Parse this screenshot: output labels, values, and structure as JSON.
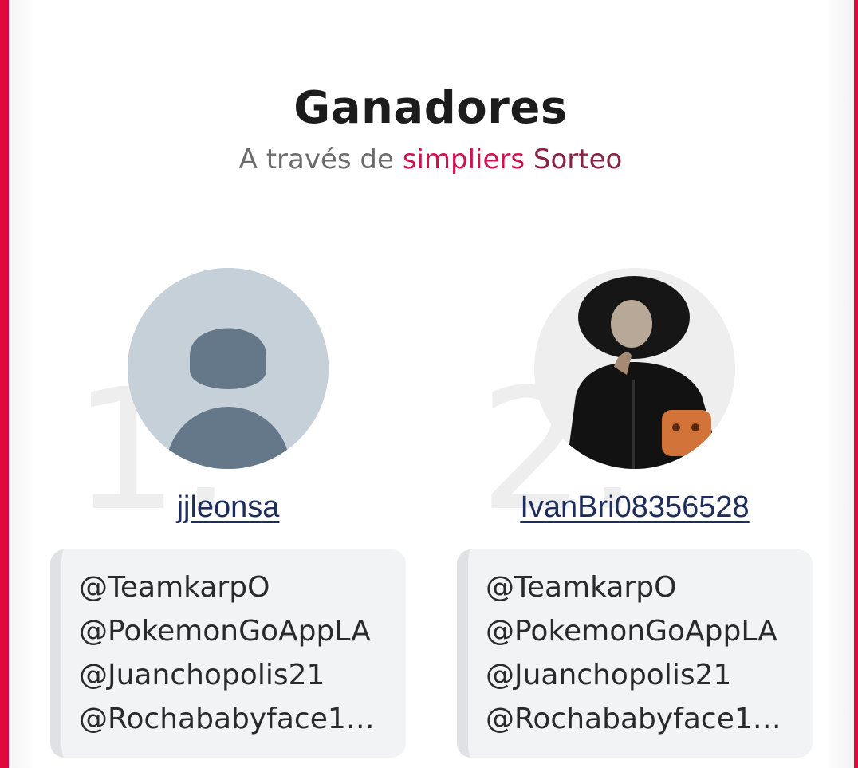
{
  "header": {
    "title": "Ganadores",
    "subtitle_prefix": "A través de",
    "brand": "simpliers",
    "subtitle_suffix": "Sorteo"
  },
  "winners": [
    {
      "rank": "1.",
      "username": "jjleonsa",
      "avatar": "default-avatar",
      "mentions": [
        "@TeamkarpO",
        "@PokemonGoAppLA",
        "@Juanchopolis21",
        "@Rochababyface1…"
      ]
    },
    {
      "rank": "2.",
      "username": "IvanBri08356528",
      "avatar": "photo-avatar",
      "mentions": [
        "@TeamkarpO",
        "@PokemonGoAppLA",
        "@Juanchopolis21",
        "@Rochababyface1…"
      ]
    }
  ],
  "colors": {
    "accent": "#e2063f",
    "brand": "#d1114f",
    "link": "#1e2e5c"
  }
}
